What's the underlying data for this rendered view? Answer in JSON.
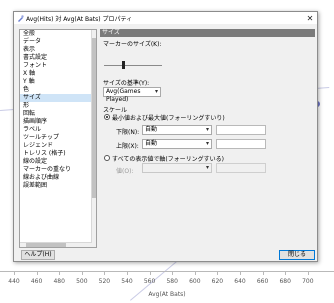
{
  "background_chart": {
    "x_ticks": [
      "440",
      "460",
      "480",
      "500",
      "520",
      "540",
      "560",
      "580",
      "600",
      "620",
      "640",
      "660",
      "680",
      "700"
    ],
    "x_label": "Avg(At Bats)"
  },
  "dialog": {
    "title": "Avg(Hits) 対 Avg(At Bats) プロパティ",
    "close_glyph": "✕"
  },
  "nav": {
    "items": [
      "全般",
      "データ",
      "表示",
      "書式設定",
      "フォント",
      "X 軸",
      "Y 軸",
      "色",
      "サイズ",
      "形",
      "回転",
      "描画順序",
      "ラベル",
      "ツールチップ",
      "レジェンド",
      "トレリス (格子)",
      "線の設定",
      "マーカーの重なり",
      "線および曲線",
      "誤差範囲"
    ],
    "selected_index": 8
  },
  "panel": {
    "header": "サイズ",
    "marker_size_label": "マーカーのサイズ(K):",
    "size_by_label": "サイズの基準(Y):",
    "size_by_value": "Avg(Games Played)",
    "scale_label": "スケール",
    "radio1_label": "最小値および最大値(フォーリングすいり)",
    "lower_label": "下限(N):",
    "lower_value": "自動",
    "upper_label": "上限(X):",
    "upper_value": "自動",
    "radio2_label": "すべての表示値で軸(フォーリングすいる)",
    "radio2_sub_label": "値(O):",
    "radio1_selected": true
  },
  "buttons": {
    "help": "ヘルプ(H)",
    "close": "閉じる"
  },
  "colors": {
    "selection": "#cfe4f7",
    "panel_header": "#7a7a7a",
    "chart_line": "#c9cbe6",
    "chart_dot": "#6f77c9"
  }
}
